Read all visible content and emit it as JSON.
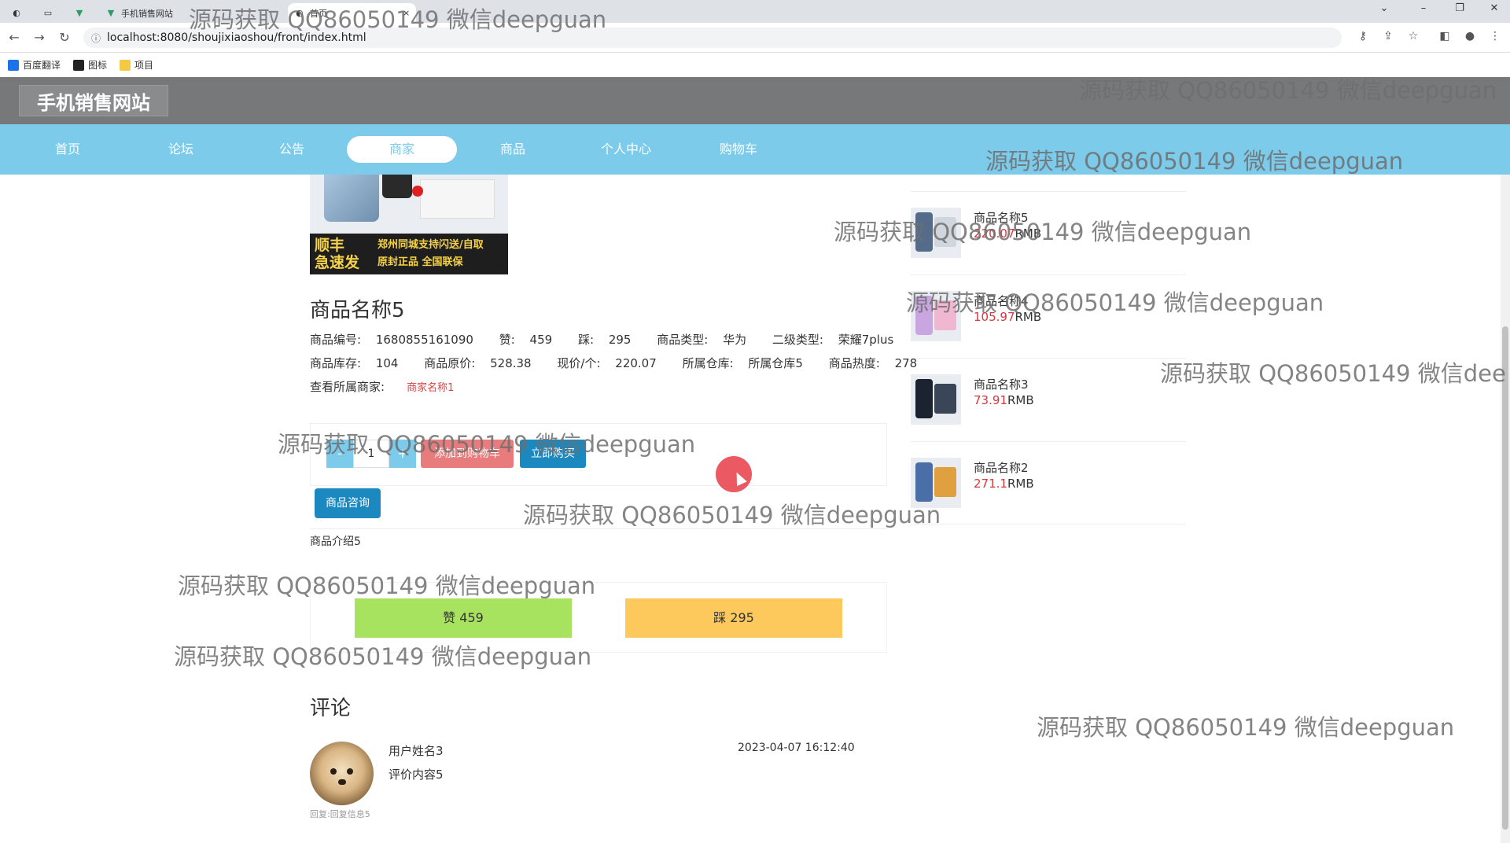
{
  "browser": {
    "tabs": [
      {
        "icon": "globe-icon",
        "label": ""
      },
      {
        "icon": "blank-icon",
        "label": ""
      },
      {
        "icon": "vue-icon",
        "label": ""
      },
      {
        "icon": "vue-icon",
        "label": "手机销售网站"
      },
      {
        "icon": "globe-icon",
        "label": "首页"
      }
    ],
    "url": "localhost:8080/shoujixiaoshou/front/index.html",
    "bookmarks": [
      {
        "icon": "translate-icon",
        "label": "百度翻译",
        "color": "#1a73e8"
      },
      {
        "icon": "image-icon",
        "label": "图标",
        "color": "#222222"
      },
      {
        "icon": "folder-icon",
        "label": "项目",
        "color": "#f6c945"
      }
    ]
  },
  "site": {
    "title": "手机销售网站",
    "nav": [
      "首页",
      "论坛",
      "公告",
      "商家",
      "商品",
      "个人中心",
      "购物车"
    ],
    "active_nav": "商家"
  },
  "product": {
    "image_banner_left": "顺丰\n急速发",
    "image_banner_right": "郑州同城支持闪送/自取\n原封正品 全国联保",
    "name": "商品名称5",
    "line1": {
      "code_label": "商品编号:",
      "code": "1680855161090",
      "likes_label": "赞:",
      "likes": "459",
      "dislikes_label": "踩:",
      "dislikes": "295",
      "type_label": "商品类型:",
      "type": "华为",
      "subtype_label": "二级类型:",
      "subtype": "荣耀7plus"
    },
    "line2": {
      "stock_label": "商品库存:",
      "stock": "104",
      "orig_price_label": "商品原价:",
      "orig_price": "528.38",
      "price_label": "现价/个:",
      "price": "220.07",
      "warehouse_label": "所属仓库:",
      "warehouse": "所属仓库5",
      "heat_label": "商品热度:",
      "heat": "278"
    },
    "merchant_label": "查看所属商家:",
    "merchant": "商家名称1",
    "qty_minus": "-",
    "qty_value": "1",
    "qty_plus": "+",
    "add_cart": "添加到购物车",
    "buy_now": "立即购买",
    "consult": "商品咨询",
    "intro": "商品介绍5",
    "like_btn": "赞  459",
    "dislike_btn": "踩  295"
  },
  "comments": {
    "title": "评论",
    "items": [
      {
        "user": "用户姓名3",
        "content": "评价内容5",
        "time": "2023-04-07 16:12:40",
        "reply": "回复:回复信息5"
      }
    ]
  },
  "sidebar": {
    "items": [
      {
        "name": "商品名称5",
        "price": "220.07",
        "unit": "RMB",
        "thumb_color": "#556b8a",
        "thumb_color2": "#d0d6de"
      },
      {
        "name": "商品名称4",
        "price": "105.97",
        "unit": "RMB",
        "thumb_color": "#c9a6e0",
        "thumb_color2": "#f0b8d0"
      },
      {
        "name": "商品名称3",
        "price": "73.91",
        "unit": "RMB",
        "thumb_color": "#1b2330",
        "thumb_color2": "#3a4658"
      },
      {
        "name": "商品名称2",
        "price": "271.1",
        "unit": "RMB",
        "thumb_color": "#4a6fa8",
        "thumb_color2": "#e0a040"
      }
    ]
  },
  "watermark": "源码获取 QQ86050149 微信deepguan",
  "watermark_clipped": "源码获取 QQ86050149 微信dee",
  "colors": {
    "nav_bg": "#7ccbea",
    "header_bg": "#777879",
    "primary_btn": "#1b88c0",
    "like": "#a8e35f",
    "dislike": "#fdc95c",
    "price": "#d9363e"
  }
}
